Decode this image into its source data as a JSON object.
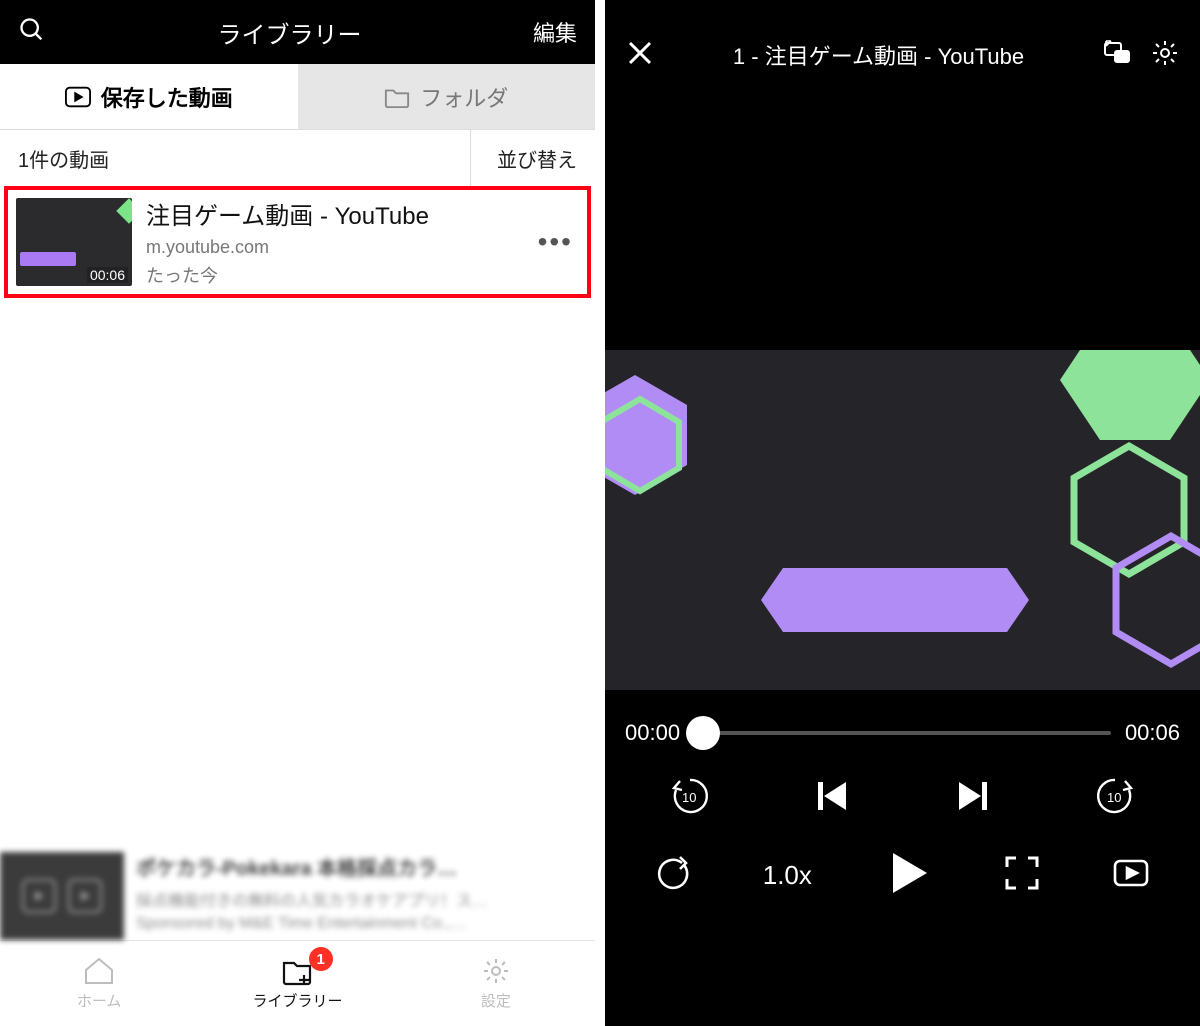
{
  "left": {
    "header": {
      "title": "ライブラリー",
      "edit": "編集"
    },
    "tabs": {
      "saved": "保存した動画",
      "folder": "フォルダ"
    },
    "list_header": {
      "count": "1件の動画",
      "sort": "並び替え"
    },
    "video": {
      "title": "注目ゲーム動画 - YouTube",
      "source": "m.youtube.com",
      "ago": "たった今",
      "duration": "00:06"
    },
    "ad": {
      "line1": "ポケカラ-Pokekara 本格採点カラ…",
      "line2": "採点機能付きの無料の人気カラオケアプリ！ス…",
      "line3": "Sponsored by M&E Time Entertainment Co.,…"
    },
    "nav": {
      "home": "ホーム",
      "library": "ライブラリー",
      "settings": "設定",
      "badge": "1"
    }
  },
  "right": {
    "title": "1 - 注目ゲーム動画 - YouTube",
    "time_current": "00:00",
    "time_total": "00:06",
    "speed": "1.0x",
    "rewind_seconds": "10",
    "forward_seconds": "10"
  }
}
